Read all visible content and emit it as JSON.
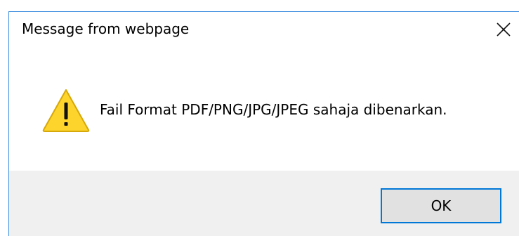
{
  "dialog": {
    "title": "Message from webpage",
    "message": "Fail Format PDF/PNG/JPG/JPEG sahaja dibenarkan.",
    "ok_label": "OK",
    "icons": {
      "close": "close-icon",
      "warning": "warning-icon"
    }
  },
  "colors": {
    "accent": "#0078d7",
    "border": "#3c8de0",
    "footer_bg": "#f0f0f0",
    "button_bg": "#e1e1e1",
    "warning_fill": "#fcd42c",
    "warning_stroke": "#d6a80a"
  }
}
